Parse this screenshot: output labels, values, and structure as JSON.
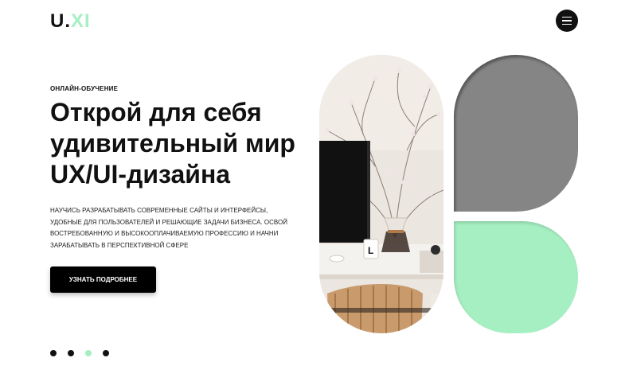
{
  "header": {
    "logo_main": "U.",
    "logo_accent": "XI",
    "menu_icon": "hamburger-menu-icon"
  },
  "hero": {
    "eyebrow": "ОНЛАЙН-ОБУЧЕНИЕ",
    "title": "Открой для себя удивительный мир UX/UI-дизайна",
    "description": "Научись разрабатывать современные сайты и интерфейсы, удобные для пользователей и решающие задачи бизнеса. Освой востребованную и высокооплачиваемую профессию и начни зарабатывать в перспективной сфере",
    "cta_label": "УЗНАТЬ ПОДРОБНЕЕ"
  },
  "slider": {
    "active_index": 2,
    "dot_count": 4
  },
  "colors": {
    "accent": "#a6efc2",
    "dark": "#111111",
    "gray_shape": "#858585"
  }
}
